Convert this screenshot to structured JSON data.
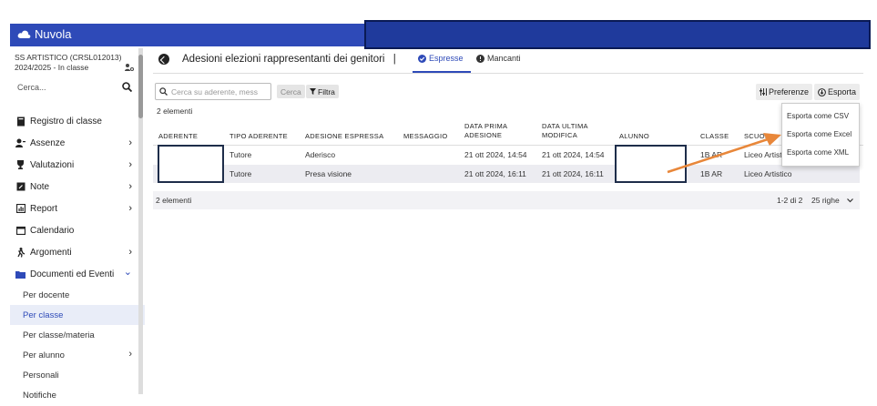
{
  "app": {
    "name": "Nuvola"
  },
  "sidebar": {
    "school_name": "SS ARTISTICO (CRSL012013)",
    "school_year": "2024/2025 - In classe",
    "search_label": "Cerca...",
    "items": [
      {
        "label": "Registro di classe",
        "icon": "book-icon",
        "chevron": ""
      },
      {
        "label": "Assenze",
        "icon": "user-minus-icon",
        "chevron": "›"
      },
      {
        "label": "Valutazioni",
        "icon": "trophy-icon",
        "chevron": "›"
      },
      {
        "label": "Note",
        "icon": "flag-icon",
        "chevron": "›"
      },
      {
        "label": "Report",
        "icon": "report-icon",
        "chevron": "›"
      },
      {
        "label": "Calendario",
        "icon": "calendar-icon",
        "chevron": ""
      },
      {
        "label": "Argomenti",
        "icon": "person-run-icon",
        "chevron": "›"
      },
      {
        "label": "Documenti ed Eventi",
        "icon": "folder-icon",
        "chevron": "⌄"
      }
    ],
    "subitems": [
      {
        "label": "Per docente",
        "active": false
      },
      {
        "label": "Per classe",
        "active": true
      },
      {
        "label": "Per classe/materia",
        "active": false
      },
      {
        "label": "Per alunno",
        "active": false
      },
      {
        "label": "Personali",
        "active": false
      },
      {
        "label": "Notifiche",
        "active": false
      }
    ],
    "per_alunno_chevron": "›"
  },
  "header": {
    "title": "Adesioni elezioni rappresentanti dei genitori",
    "separator": "|",
    "tab_espresse": "Espresse",
    "tab_mancanti": "Mancanti"
  },
  "toolbar": {
    "search_placeholder": "Cerca su aderente, mess",
    "cerca_label": "Cerca",
    "filtra_label": "Filtra",
    "preferenze_label": "Preferenze",
    "esporta_label": "Esporta"
  },
  "count_label": "2 elementi",
  "table": {
    "headers": [
      "ADERENTE",
      "TIPO ADERENTE",
      "ADESIONE ESPRESSA",
      "MESSAGGIO",
      "DATA PRIMA ADESIONE",
      "DATA ULTIMA MODIFICA",
      "ALUNNO",
      "CLASSE",
      "SCUOLA"
    ],
    "header_lines": {
      "data_prima": [
        "DATA PRIMA",
        "ADESIONE"
      ],
      "data_ultima": [
        "DATA ULTIMA",
        "MODIFICA"
      ]
    },
    "rows": [
      {
        "tipo": "Tutore",
        "adesione": "Aderisco",
        "messaggio": "",
        "data_prima": "21 ott 2024, 14:54",
        "data_ultima": "21 ott 2024, 14:54",
        "classe": "1B AR",
        "scuola": "Liceo Artistico"
      },
      {
        "tipo": "Tutore",
        "adesione": "Presa visione",
        "messaggio": "",
        "data_prima": "21 ott 2024, 16:11",
        "data_ultima": "21 ott 2024, 16:11",
        "classe": "1B AR",
        "scuola": "Liceo Artistico"
      }
    ]
  },
  "footer": {
    "count": "2 elementi",
    "pager": "1-2 di 2",
    "rows_per_page": "25 righe"
  },
  "export_menu": {
    "items": [
      "Esporta come CSV",
      "Esporta come Excel",
      "Esporta come XML"
    ]
  },
  "colors": {
    "brand": "#2e4ab8",
    "arrow": "#e8873a"
  }
}
